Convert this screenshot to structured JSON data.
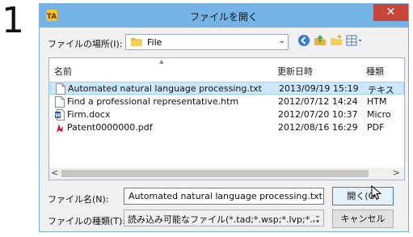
{
  "step": "1",
  "dialog": {
    "title": "ファイルを開く",
    "close": "✕"
  },
  "location": {
    "label": "ファイルの場所(I):",
    "value": "File"
  },
  "columns": {
    "name": "名前",
    "modified": "更新日時",
    "type": "種類"
  },
  "files": [
    {
      "name": "Automated natural language processing.txt",
      "date": "2013/09/19 15:19",
      "type": "テキス",
      "icon": "text-file-icon",
      "selected": true
    },
    {
      "name": "Find a professional representative.htm",
      "date": "2012/07/12 14:24",
      "type": "HTM",
      "icon": "html-file-icon",
      "selected": false
    },
    {
      "name": "Firm.docx",
      "date": "2012/07/20 10:37",
      "type": "Micro",
      "icon": "word-file-icon",
      "selected": false
    },
    {
      "name": "Patent0000000.pdf",
      "date": "2012/08/16 16:29",
      "type": "PDF",
      "icon": "pdf-file-icon",
      "selected": false
    }
  ],
  "filename": {
    "label": "ファイル名(N):",
    "value": "Automated natural language processing.txt"
  },
  "filetype": {
    "label": "ファイルの種類(T):",
    "value": "読み込み可能なファイル(*.tad;*.wsp;*.lvp;*.lv"
  },
  "buttons": {
    "open": "開く(O)",
    "cancel": "キャンセル"
  },
  "scroll": {
    "left": "<",
    "right": ">"
  }
}
